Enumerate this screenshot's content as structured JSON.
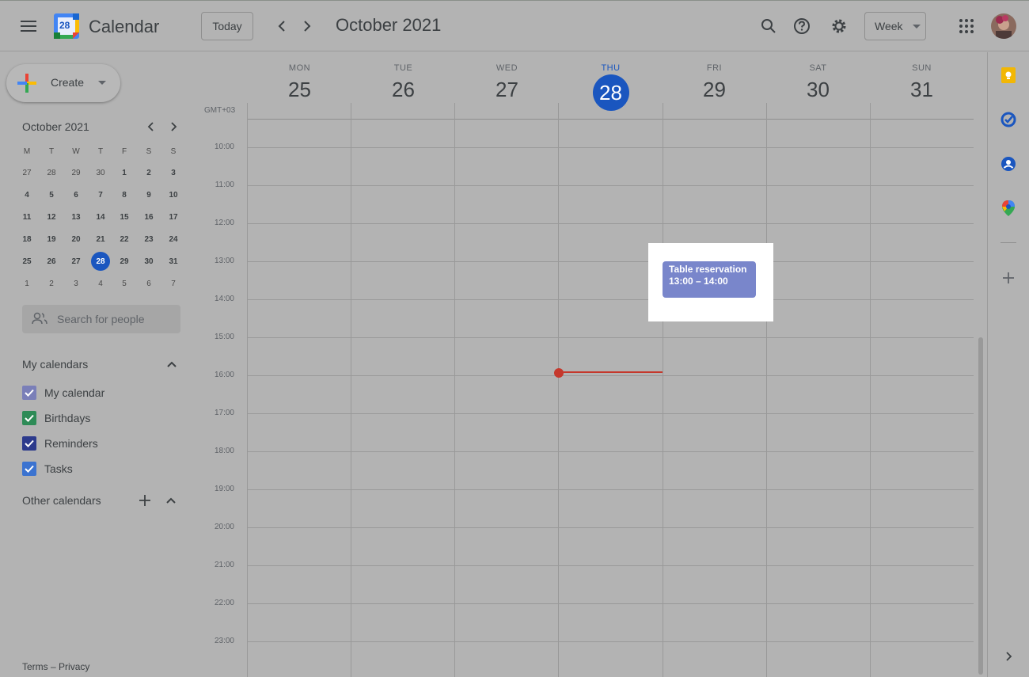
{
  "header": {
    "app_name": "Calendar",
    "logo_day": "28",
    "today_label": "Today",
    "current_period": "October 2021",
    "view_label": "Week"
  },
  "sidebar": {
    "create_label": "Create",
    "mini_calendar": {
      "title": "October 2021",
      "weekday_headers": [
        "M",
        "T",
        "W",
        "T",
        "F",
        "S",
        "S"
      ],
      "weeks": [
        [
          "27",
          "28",
          "29",
          "30",
          "1",
          "2",
          "3"
        ],
        [
          "4",
          "5",
          "6",
          "7",
          "8",
          "9",
          "10"
        ],
        [
          "11",
          "12",
          "13",
          "14",
          "15",
          "16",
          "17"
        ],
        [
          "18",
          "19",
          "20",
          "21",
          "22",
          "23",
          "24"
        ],
        [
          "25",
          "26",
          "27",
          "28",
          "29",
          "30",
          "31"
        ],
        [
          "1",
          "2",
          "3",
          "4",
          "5",
          "6",
          "7"
        ]
      ]
    },
    "search_people_placeholder": "Search for people",
    "my_calendars_title": "My calendars",
    "my_calendars": [
      {
        "label": "My calendar",
        "color": "#7a7fb8"
      },
      {
        "label": "Birthdays",
        "color": "#2e8b57"
      },
      {
        "label": "Reminders",
        "color": "#2c3a8c"
      },
      {
        "label": "Tasks",
        "color": "#3b73d0"
      }
    ],
    "other_calendars_title": "Other calendars",
    "footer": {
      "terms": "Terms",
      "separator": "–",
      "privacy": "Privacy"
    }
  },
  "week": {
    "timezone": "GMT+03",
    "days": [
      {
        "name": "MON",
        "num": "25"
      },
      {
        "name": "TUE",
        "num": "26"
      },
      {
        "name": "WED",
        "num": "27"
      },
      {
        "name": "THU",
        "num": "28",
        "today": true
      },
      {
        "name": "FRI",
        "num": "29"
      },
      {
        "name": "SAT",
        "num": "30"
      },
      {
        "name": "SUN",
        "num": "31"
      }
    ],
    "hours": [
      "10:00",
      "11:00",
      "12:00",
      "13:00",
      "14:00",
      "15:00",
      "16:00",
      "17:00",
      "18:00",
      "19:00",
      "20:00",
      "21:00",
      "22:00",
      "23:00"
    ]
  },
  "event": {
    "title": "Table reservation",
    "time": "13:00 – 14:00",
    "color": "#7986cb"
  },
  "colors": {
    "accent_blue": "#1a56bf",
    "now_line": "#c5382c"
  }
}
